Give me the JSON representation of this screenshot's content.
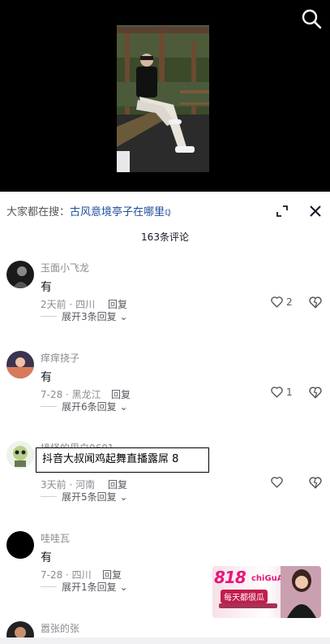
{
  "video": {
    "search_icon": "search-icon"
  },
  "sheet": {
    "search_prefix": "大家都在搜：",
    "search_keyword": "古风意境亭子在哪里",
    "search_glyph": "ℚ",
    "comment_count": "163条评论",
    "icons": {
      "expand": "expand-icon",
      "close": "close-icon"
    }
  },
  "comments": [
    {
      "username": "玉面小飞龙",
      "text": "有",
      "date_location": "2天前 · 四川",
      "reply": "回复",
      "likes": "2",
      "expand": "展开3条回复"
    },
    {
      "username": "痒痒挠子",
      "text": "有",
      "date_location": "7-28 · 黑龙江",
      "reply": "回复",
      "likes": "1",
      "expand": "展开6条回复"
    },
    {
      "username": "境怪的里白0601",
      "text": "",
      "date_location": "3天前 · 河南",
      "reply": "回复",
      "likes": "",
      "expand": "展开5条回复"
    },
    {
      "username": "哇哇瓦",
      "text": "有",
      "date_location": "7-28 · 四川",
      "reply": "回复",
      "likes": "",
      "expand": "展开1条回复"
    },
    {
      "username": "嚣张的张",
      "text": "",
      "date_location": "",
      "reply": "",
      "likes": "",
      "expand": ""
    }
  ],
  "overlay_text": "抖音大叔闻鸡起舞直播露屌 8",
  "ad": {
    "brand": "818",
    "brand_sub": "chiGuA",
    "slogan": "每天都很瓜"
  },
  "colors": {
    "link": "#1e4f9a",
    "muted": "#8a8b91",
    "ad_pink": "#e5177b"
  }
}
